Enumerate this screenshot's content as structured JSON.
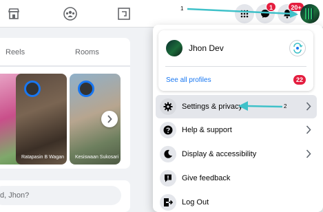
{
  "topbar": {
    "notification_count": "1",
    "account_badge": "20+"
  },
  "stories": {
    "tabs": [
      "Reels",
      "Rooms"
    ],
    "cards": [
      {
        "name": ""
      },
      {
        "name": "Ratapasin B Wagan"
      },
      {
        "name": "Kesiswaan Sukosari"
      }
    ]
  },
  "composer": {
    "placeholder": "d, Jhon?"
  },
  "account_menu": {
    "profile_name": "Jhon Dev",
    "see_all_profiles": "See all profiles",
    "profiles_count": "22",
    "items": [
      {
        "label": "Settings & privacy",
        "icon": "gear-icon",
        "has_chevron": true
      },
      {
        "label": "Help & support",
        "icon": "help-icon",
        "has_chevron": true
      },
      {
        "label": "Display & accessibility",
        "icon": "moon-icon",
        "has_chevron": true
      },
      {
        "label": "Give feedback",
        "icon": "feedback-icon",
        "has_chevron": false
      },
      {
        "label": "Log Out",
        "icon": "logout-icon",
        "has_chevron": false
      }
    ]
  },
  "annotations": {
    "step_1": "1",
    "step_2": "2"
  },
  "colors": {
    "accent": "#1877f2",
    "badge_red": "#e41e3f",
    "annotation_teal": "#3fc1c9"
  }
}
